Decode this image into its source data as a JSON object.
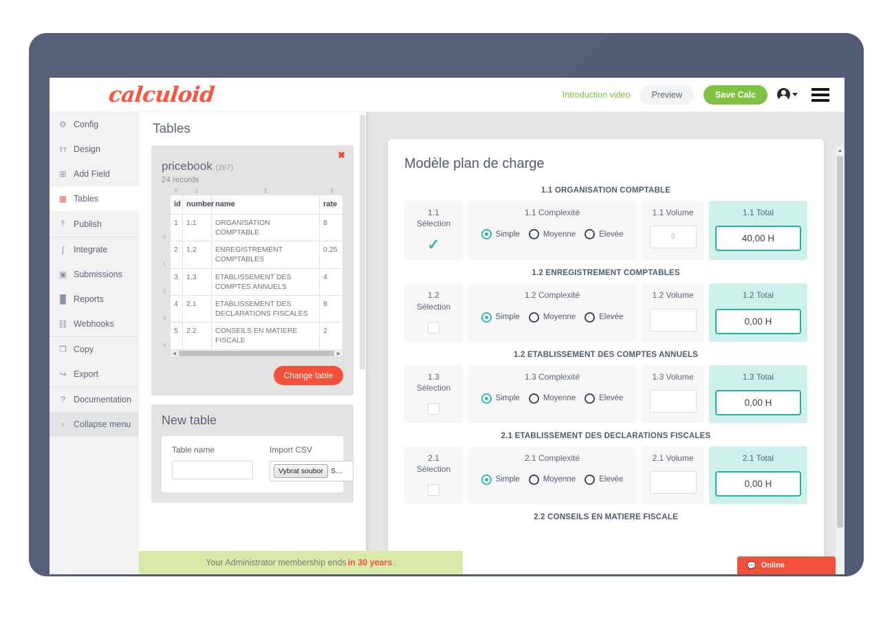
{
  "topbar": {
    "logo": "calculoid",
    "intro_video": "Introduction video",
    "preview": "Preview",
    "save_calc": "Save Calc"
  },
  "sidebar": {
    "items": [
      {
        "label": "Config",
        "icon": "gear-icon",
        "glyph": "⚙",
        "active": false
      },
      {
        "label": "Design",
        "icon": "text-style-icon",
        "glyph": "ᴛᴛ",
        "active": false
      },
      {
        "label": "Add Field",
        "icon": "add-field-icon",
        "glyph": "⊞",
        "active": false
      },
      {
        "label": "Tables",
        "icon": "table-icon",
        "glyph": "▦",
        "active": true
      },
      {
        "label": "Publish",
        "icon": "publish-icon",
        "glyph": "⤒",
        "active": false
      },
      {
        "label": "Integrate",
        "icon": "integrate-icon",
        "glyph": "ʃ",
        "active": false
      },
      {
        "label": "Submissions",
        "icon": "submissions-icon",
        "glyph": "▣",
        "active": false
      },
      {
        "label": "Reports",
        "icon": "reports-icon",
        "glyph": "█",
        "active": false
      },
      {
        "label": "Webhooks",
        "icon": "webhooks-icon",
        "glyph": "⛓",
        "active": false
      },
      {
        "label": "Copy",
        "icon": "copy-icon",
        "glyph": "❐",
        "active": false
      },
      {
        "label": "Export",
        "icon": "export-icon",
        "glyph": "↪",
        "active": false
      },
      {
        "label": "Documentation",
        "icon": "help-icon",
        "glyph": "?",
        "active": false
      }
    ],
    "collapse": {
      "label": "Collapse menu",
      "icon": "chevron-left-icon",
      "glyph": "‹"
    }
  },
  "tables_panel": {
    "title": "Tables",
    "close_glyph": "✖",
    "table_name": "pricebook",
    "table_id": "(267)",
    "records": "24 records",
    "column_indices": [
      "0",
      "1",
      "2",
      "3"
    ],
    "columns": [
      "id",
      "number",
      "name",
      "rate"
    ],
    "rows": [
      {
        "index": "0",
        "id": "1",
        "number": "1.1",
        "name": "ORGANISATION COMPTABLE",
        "rate": "8"
      },
      {
        "index": "1",
        "id": "2",
        "number": "1.2",
        "name": "ENREGISTREMENT COMPTABLES",
        "rate": "0.25"
      },
      {
        "index": "2",
        "id": "3",
        "number": "1.3",
        "name": "ETABLISSEMENT DES COMPTES ANNUELS",
        "rate": "4"
      },
      {
        "index": "3",
        "id": "4",
        "number": "2.1",
        "name": "ETABLISSEMENT DES DECLARATIONS FISCALES",
        "rate": "8"
      },
      {
        "index": "4",
        "id": "5",
        "number": "2.2",
        "name": "CONSEILS EN MATIERE FISCALE",
        "rate": "2"
      }
    ],
    "change_table": "Change table",
    "new_table": {
      "title": "New table",
      "table_name_label": "Table name",
      "table_name_value": "",
      "import_csv_label": "Import CSV",
      "file_button": "Vybrat soubor",
      "file_status": "S…"
    }
  },
  "calculator": {
    "title": "Modèle plan de charge",
    "radio_options": [
      "Simple",
      "Moyenne",
      "Elevée"
    ],
    "sections": [
      {
        "heading": "1.1 ORGANISATION COMPTABLE",
        "sel_label": "1.1\nSélection",
        "sel_type": "check",
        "cplx_label": "1.1 Complexité",
        "cplx_selected": 0,
        "vol_label": "1.1 Volume",
        "vol_value": "5",
        "tot_label": "1.1 Total",
        "tot_value": "40,00 H"
      },
      {
        "heading": "1.2 ENREGISTREMENT COMPTABLES",
        "sel_label": "1.2\nSélection",
        "sel_type": "box",
        "cplx_label": "1.2 Complexité",
        "cplx_selected": 0,
        "vol_label": "1.2 Volume",
        "vol_value": "",
        "tot_label": "1.2 Total",
        "tot_value": "0,00 H"
      },
      {
        "heading": "1.2 ETABLISSEMENT DES COMPTES ANNUELS",
        "sel_label": "1.3\nSélection",
        "sel_type": "box",
        "cplx_label": "1.3 Complexité",
        "cplx_selected": 0,
        "vol_label": "1.3 Volume",
        "vol_value": "",
        "tot_label": "1.3 Total",
        "tot_value": "0,00 H"
      },
      {
        "heading": "2.1 ETABLISSEMENT DES DECLARATIONS FISCALES",
        "sel_label": "2.1\nSélection",
        "sel_type": "box",
        "cplx_label": "2.1 Complexité",
        "cplx_selected": 0,
        "vol_label": "2.1 Volume",
        "vol_value": "",
        "tot_label": "2.1 Total",
        "tot_value": "0,00 H"
      },
      {
        "heading": "2.2 CONSEILS EN MATIERE FISCALE",
        "partial": true
      }
    ]
  },
  "membership": {
    "prefix": "Your Administrator membership ends ",
    "highlight": "in 30 years",
    "suffix": "."
  },
  "chat": {
    "label": "Online",
    "icon": "chat-bubble-icon"
  },
  "colors": {
    "brand_red": "#ff5240",
    "save_green": "#7fc241",
    "teal": "#2cbba6",
    "teal_border": "#21b39b",
    "teal_bg": "#cdf0ea",
    "slate": "#525a74",
    "member_bg": "#d9eaa8"
  }
}
